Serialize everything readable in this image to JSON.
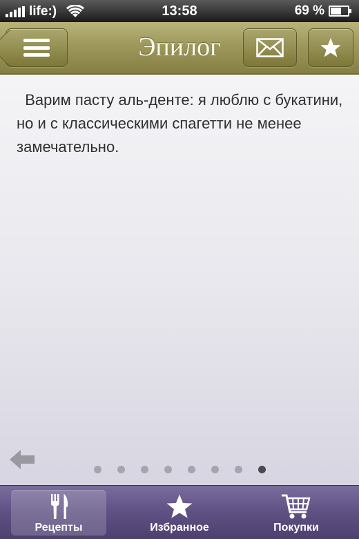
{
  "status_bar": {
    "carrier": "life:)",
    "time": "13:58",
    "battery_percent": "69 %",
    "battery_level": 0.69,
    "signal_bars": 5
  },
  "nav": {
    "title": "Эпилог",
    "menu_icon": "menu-icon",
    "mail_icon": "envelope-icon",
    "favorite_icon": "star-icon"
  },
  "content": {
    "text": "Варим пасту аль-денте: я люблю с букатини, но и с классическими спагетти не менее замечательно."
  },
  "pager": {
    "total": 8,
    "current": 8
  },
  "tabs": [
    {
      "label": "Рецепты",
      "icon": "fork-knife-icon",
      "active": true
    },
    {
      "label": "Избранное",
      "icon": "star-icon",
      "active": false
    },
    {
      "label": "Покупки",
      "icon": "cart-icon",
      "active": false
    }
  ],
  "colors": {
    "navbar": "#9e985c",
    "tabbar": "#5e5082",
    "content_bg": "#e9e8ee"
  }
}
